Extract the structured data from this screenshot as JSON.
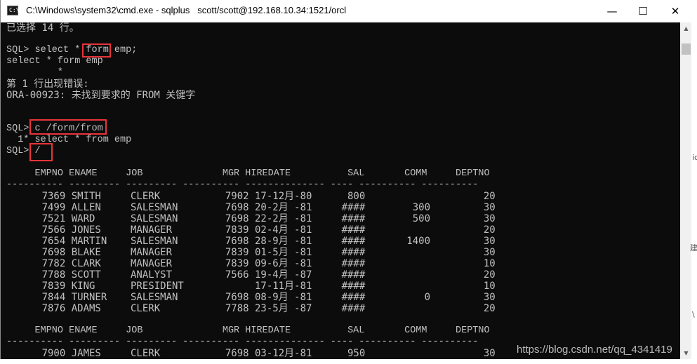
{
  "window": {
    "title": "C:\\Windows\\system32\\cmd.exe - sqlplus   scott/scott@192.168.10.34:1521/orcl",
    "icon_label": "C:\\",
    "minimize_glyph": "—",
    "maximize_glyph": "☐",
    "close_glyph": "✕"
  },
  "console": {
    "lines": [
      "已选择 14 行。",
      "",
      "SQL> select * form emp;",
      "select * form emp",
      "         *",
      "第 1 行出现错误:",
      "ORA-00923: 未找到要求的 FROM 关键字",
      "",
      "",
      "SQL> c /form/from",
      "  1* select * from emp",
      "SQL> /",
      "",
      "     EMPNO ENAME     JOB              MGR HIREDATE          SAL       COMM     DEPTNO",
      "---------- --------- --------- ---------- -------------- ---- ---------- ----------",
      "      7369 SMITH     CLERK           7902 17-12月-80      800                    20",
      "      7499 ALLEN     SALESMAN        7698 20-2月 -81     ####        300         30",
      "      7521 WARD      SALESMAN        7698 22-2月 -81     ####        500         30",
      "      7566 JONES     MANAGER         7839 02-4月 -81     ####                    20",
      "      7654 MARTIN    SALESMAN        7698 28-9月 -81     ####       1400         30",
      "      7698 BLAKE     MANAGER         7839 01-5月 -81     ####                    30",
      "      7782 CLARK     MANAGER         7839 09-6月 -81     ####                    10",
      "      7788 SCOTT     ANALYST         7566 19-4月 -87     ####                    20",
      "      7839 KING      PRESIDENT            17-11月-81     ####                    10",
      "      7844 TURNER    SALESMAN        7698 08-9月 -81     ####          0         30",
      "      7876 ADAMS     CLERK           7788 23-5月 -87     ####                    20",
      "",
      "     EMPNO ENAME     JOB              MGR HIREDATE          SAL       COMM     DEPTNO",
      "---------- --------- --------- ---------- -------------- ---- ---------- ----------",
      "      7900 JAMES     CLERK           7698 03-12月-81      950                    30"
    ],
    "highlighted": [
      "form",
      "c /form/from",
      "/"
    ],
    "highlight_color": "#e8343a",
    "text_color": "#c0c0c0",
    "background_color": "#0c0c0c"
  },
  "scrollbar": {
    "up_glyph": "▲",
    "down_glyph": "▼"
  },
  "background_fragments": [
    "ic",
    "建",
    "\\"
  ],
  "watermark": "https://blog.csdn.net/qq_4341419"
}
